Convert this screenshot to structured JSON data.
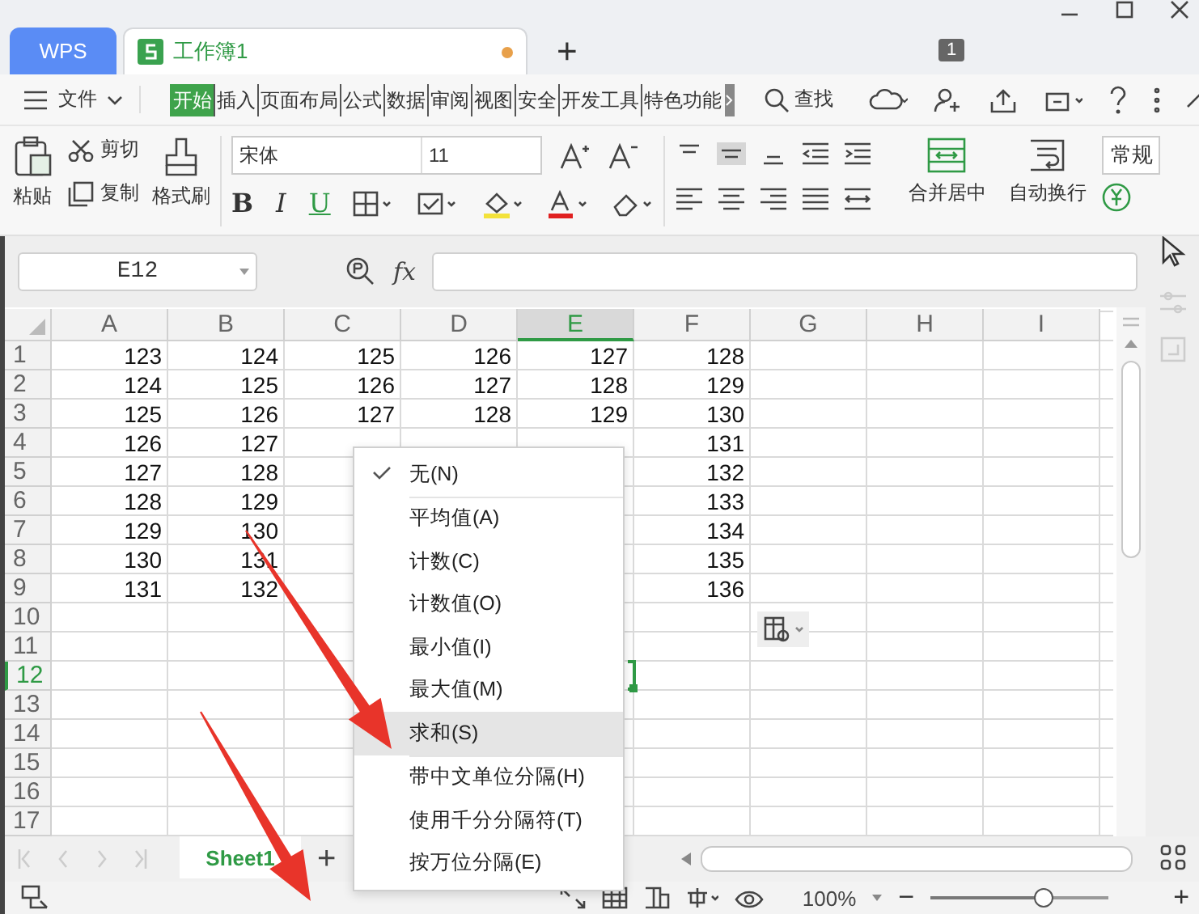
{
  "window": {
    "tabs": [
      {
        "label": "WPS",
        "kind": "home",
        "selected": false
      },
      {
        "label": "工作簿1",
        "kind": "sheet",
        "selected": true,
        "unsaved": true
      }
    ],
    "new_tab": "+",
    "badge": "1"
  },
  "menu_bar": {
    "file": "文件",
    "tabs": [
      {
        "label": "开始",
        "selected": true
      },
      {
        "label": "插入",
        "selected": false
      },
      {
        "label": "页面布局",
        "selected": false
      },
      {
        "label": "公式",
        "selected": false
      },
      {
        "label": "数据",
        "selected": false
      },
      {
        "label": "审阅",
        "selected": false
      },
      {
        "label": "视图",
        "selected": false
      },
      {
        "label": "安全",
        "selected": false
      },
      {
        "label": "开发工具",
        "selected": false
      },
      {
        "label": "特色功能",
        "selected": false
      }
    ],
    "search": "查找"
  },
  "ribbon": {
    "paste": "粘贴",
    "cut": "剪切",
    "copy": "复制",
    "format_painter": "格式刷",
    "font": "宋体",
    "font_size": "11",
    "font_styles": [
      "B",
      "I",
      "U"
    ],
    "merge": "合并居中",
    "wrap": "自动换行",
    "number_format": "常规"
  },
  "formula_bar": {
    "name_box": "E12",
    "function_label": "fx"
  },
  "sheet": {
    "columns": [
      {
        "label": "A",
        "selected": false
      },
      {
        "label": "B",
        "selected": false
      },
      {
        "label": "C",
        "selected": false
      },
      {
        "label": "D",
        "selected": false
      },
      {
        "label": "E",
        "selected": true
      },
      {
        "label": "F",
        "selected": false
      },
      {
        "label": "G",
        "selected": false
      },
      {
        "label": "H",
        "selected": false
      },
      {
        "label": "I",
        "selected": false
      }
    ],
    "rows": [
      {
        "label": "1",
        "selected": false,
        "cells": [
          "123",
          "124",
          "125",
          "126",
          "127",
          "128"
        ]
      },
      {
        "label": "2",
        "selected": false,
        "cells": [
          "124",
          "125",
          "126",
          "127",
          "128",
          "129"
        ]
      },
      {
        "label": "3",
        "selected": false,
        "cells": [
          "125",
          "126",
          "127",
          "128",
          "129",
          "130"
        ]
      },
      {
        "label": "4",
        "selected": false,
        "cells": [
          "126",
          "127",
          null,
          null,
          null,
          "131"
        ]
      },
      {
        "label": "5",
        "selected": false,
        "cells": [
          "127",
          "128",
          null,
          null,
          null,
          "132"
        ]
      },
      {
        "label": "6",
        "selected": false,
        "cells": [
          "128",
          "129",
          null,
          null,
          null,
          "133"
        ]
      },
      {
        "label": "7",
        "selected": false,
        "cells": [
          "129",
          "130",
          null,
          null,
          null,
          "134"
        ]
      },
      {
        "label": "8",
        "selected": false,
        "cells": [
          "130",
          "131",
          null,
          null,
          null,
          "135"
        ]
      },
      {
        "label": "9",
        "selected": false,
        "cells": [
          "131",
          "132",
          null,
          null,
          null,
          "136"
        ]
      },
      {
        "label": "10",
        "selected": false
      },
      {
        "label": "11",
        "selected": false
      },
      {
        "label": "12",
        "selected": true
      },
      {
        "label": "13",
        "selected": false
      },
      {
        "label": "14",
        "selected": false
      },
      {
        "label": "15",
        "selected": false
      },
      {
        "label": "16",
        "selected": false
      },
      {
        "label": "17",
        "selected": false
      }
    ]
  },
  "context_menu": [
    {
      "label": "无(N)",
      "checked": true,
      "highlighted": false,
      "separator_after": true
    },
    {
      "label": "平均值(A)",
      "checked": false,
      "highlighted": false,
      "separator_after": false
    },
    {
      "label": "计数(C)",
      "checked": false,
      "highlighted": false,
      "separator_after": false
    },
    {
      "label": "计数值(O)",
      "checked": false,
      "highlighted": false,
      "separator_after": false
    },
    {
      "label": "最小值(I)",
      "checked": false,
      "highlighted": false,
      "separator_after": false
    },
    {
      "label": "最大值(M)",
      "checked": false,
      "highlighted": false,
      "separator_after": false
    },
    {
      "label": "求和(S)",
      "checked": false,
      "highlighted": true,
      "separator_after": true
    },
    {
      "label": "带中文单位分隔(H)",
      "checked": false,
      "highlighted": false,
      "separator_after": false
    },
    {
      "label": "使用千分分隔符(T)",
      "checked": false,
      "highlighted": false,
      "separator_after": false
    },
    {
      "label": "按万位分隔(E)",
      "checked": false,
      "highlighted": false,
      "separator_after": false
    }
  ],
  "sheet_tabs": [
    {
      "label": "Sheet1",
      "selected": true
    }
  ],
  "add_sheet": "+",
  "status_bar": {
    "zoom": "100%",
    "zoom_out": "−",
    "zoom_slider": {
      "level": 0.64
    },
    "zoom_in": "+"
  },
  "overlay_arrows": [
    {
      "kind": "arrow"
    },
    {
      "kind": "arrow"
    }
  ]
}
